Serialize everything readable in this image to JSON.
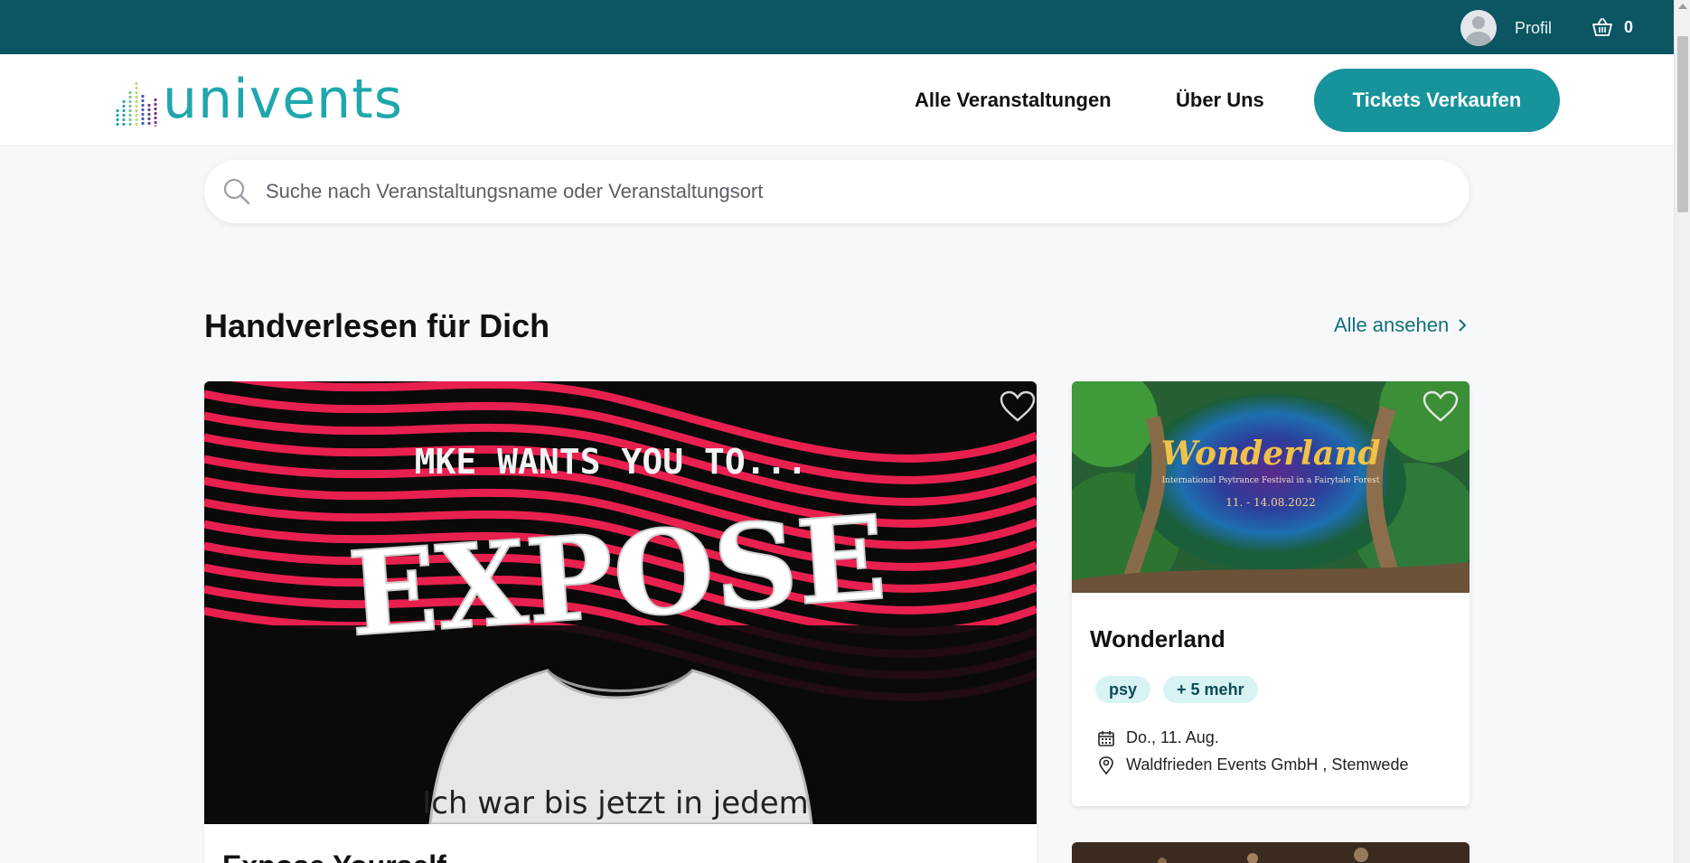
{
  "topbar": {
    "profile_label": "Profil",
    "cart_count": "0",
    "profile_icon": "user-avatar-icon",
    "cart_icon": "basket-icon"
  },
  "header": {
    "logo_text": "univents",
    "nav": {
      "all_events": "Alle Veranstaltungen",
      "about": "Über Uns"
    },
    "cta_label": "Tickets Verkaufen"
  },
  "search": {
    "placeholder": "Suche nach Veranstaltungsname oder Veranstaltungsort"
  },
  "section": {
    "title": "Handverlesen für Dich",
    "see_all": "Alle ansehen"
  },
  "featured": {
    "image_text_top": "MKE WANTS YOU TO...",
    "image_text_main": "EXPOSE",
    "image_text_shirt": "Ich war bis jetzt in jedem",
    "title": "Expose Yourself"
  },
  "cards": [
    {
      "image_title": "Wonderland",
      "image_subtitle": "International Psytrance Festival in a Fairytale Forest",
      "image_dates": "11. - 14.08.2022",
      "title": "Wonderland",
      "tags": [
        "psy",
        "+ 5 mehr"
      ],
      "date": "Do., 11. Aug.",
      "location": "Waldfrieden Events GmbH , Stemwede"
    }
  ],
  "colors": {
    "topbar": "#0b5662",
    "accent": "#16939b",
    "link": "#11707a",
    "tag_bg": "#d8f3f4"
  }
}
